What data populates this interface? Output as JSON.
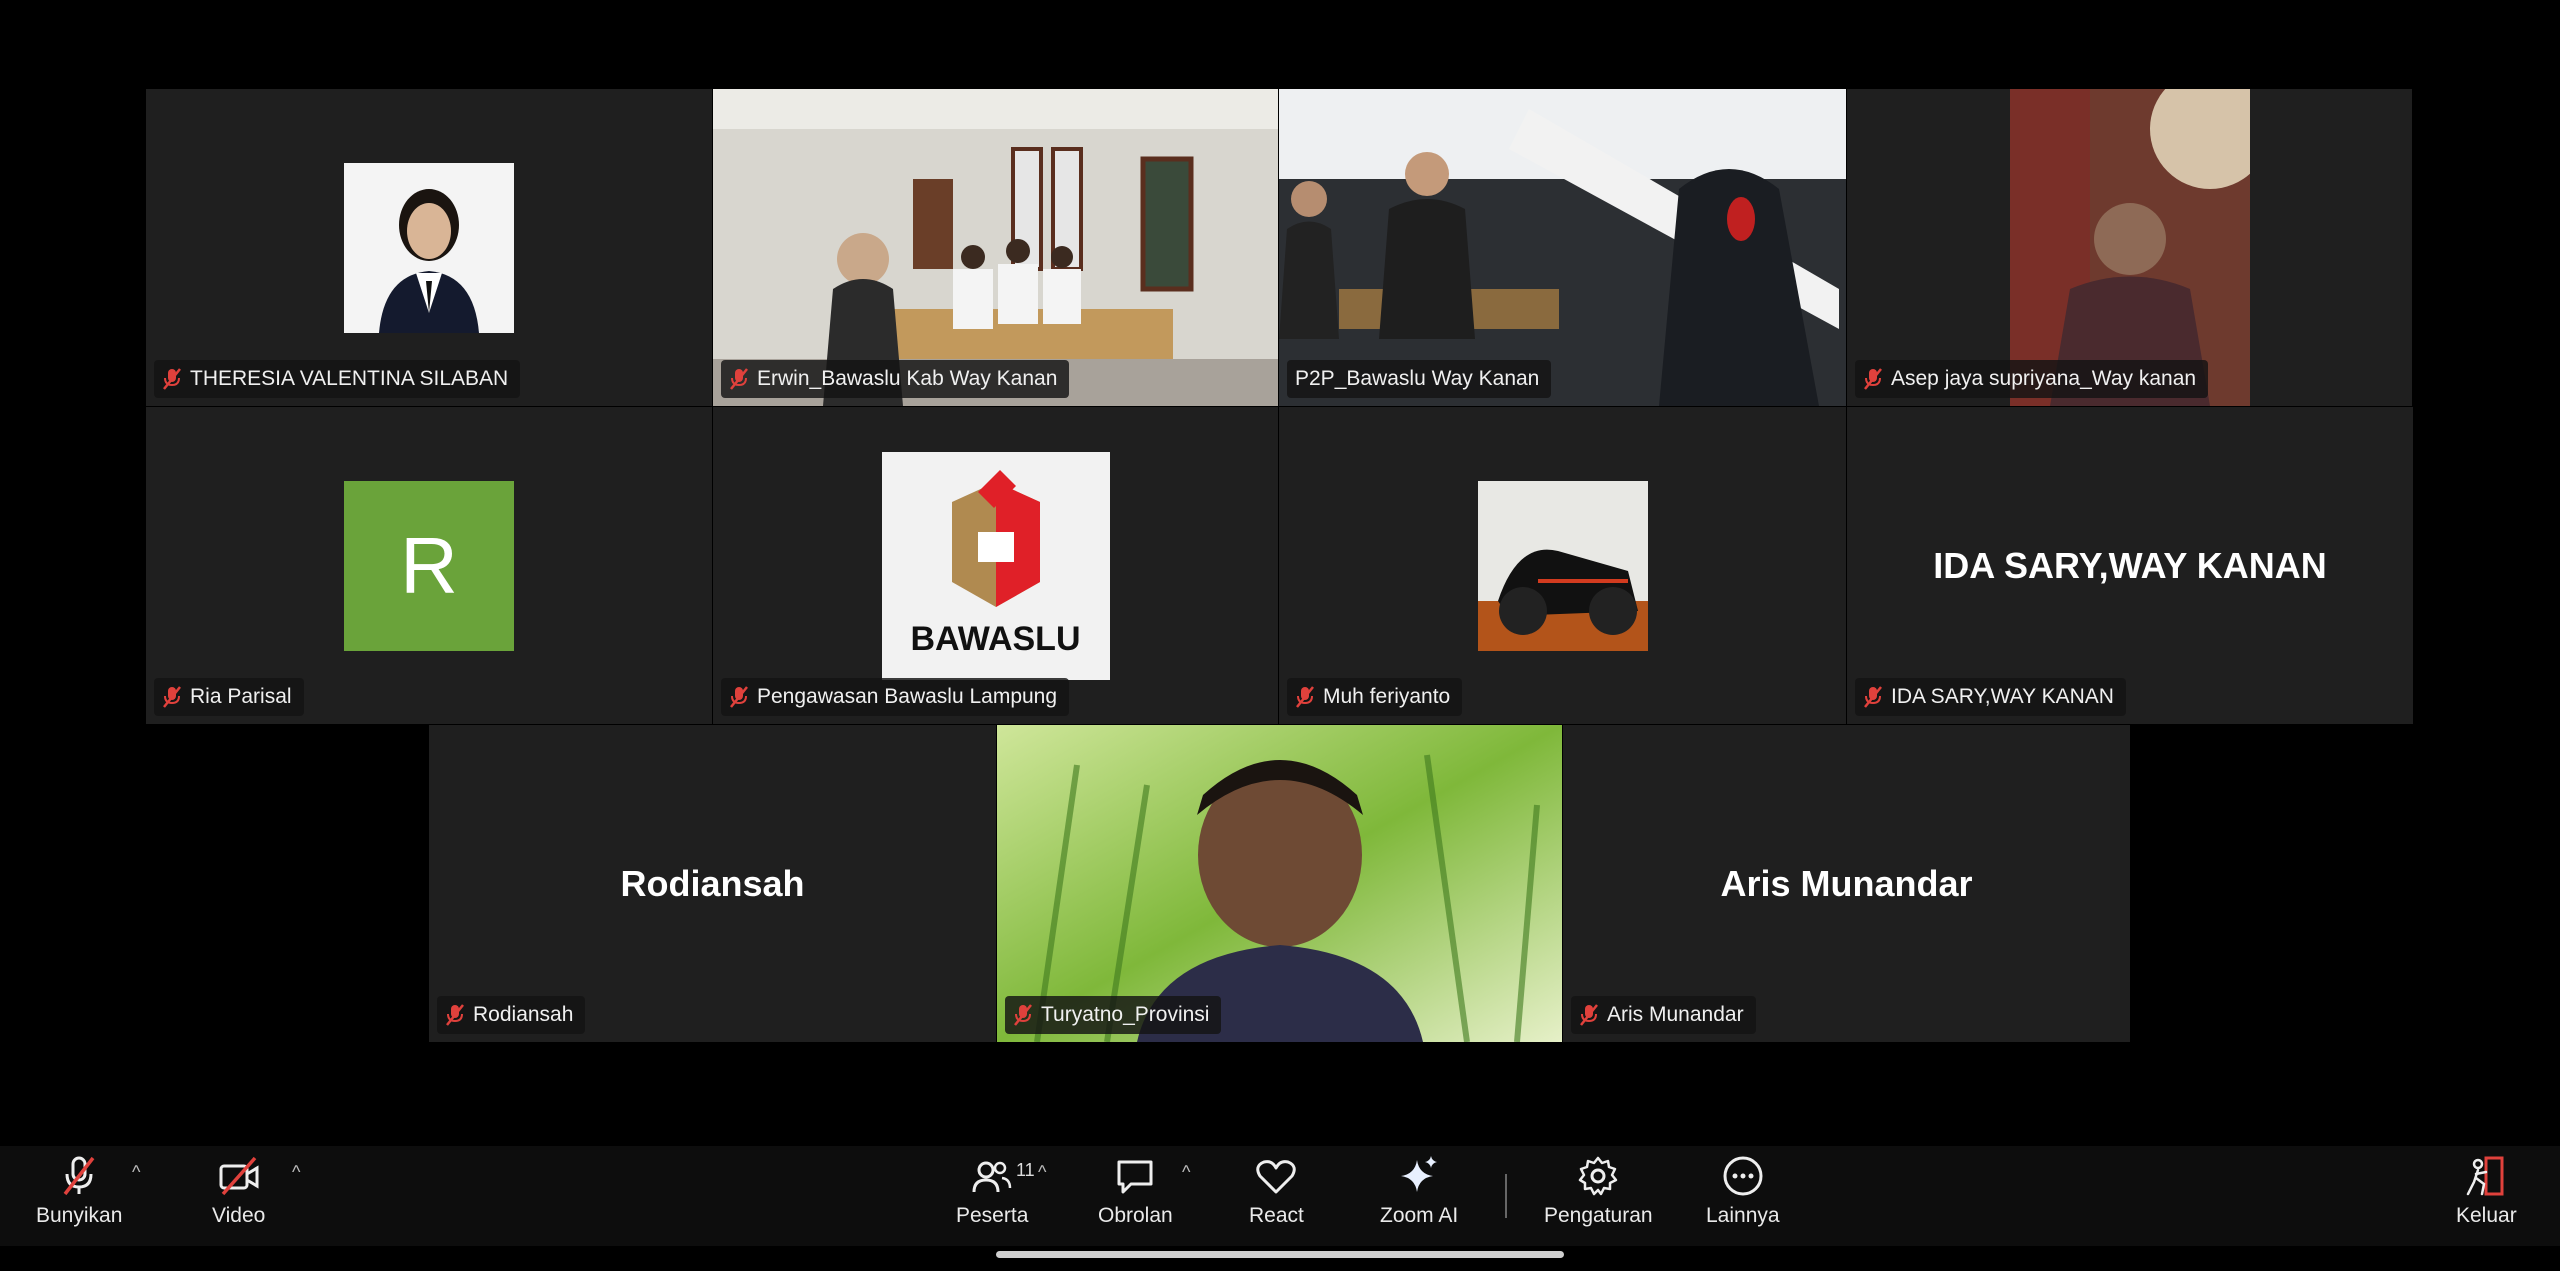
{
  "tiles": [
    {
      "name": "THERESIA VALENTINA SILABAN",
      "type": "photo"
    },
    {
      "name": "Erwin_Bawaslu Kab Way Kanan",
      "type": "video"
    },
    {
      "name": "P2P_Bawaslu Way Kanan",
      "type": "video",
      "active": true
    },
    {
      "name": "Asep jaya supriyana_Way kanan",
      "type": "video"
    },
    {
      "name": "Ria Parisal",
      "type": "initial",
      "initial": "R",
      "color": "#6aa33a"
    },
    {
      "name": "Pengawasan Bawaslu Lampung",
      "type": "logo"
    },
    {
      "name": "Muh feriyanto",
      "type": "photo"
    },
    {
      "name": "IDA SARY,WAY KANAN",
      "type": "name",
      "display": "IDA SARY,WAY KANAN"
    },
    {
      "name": "Rodiansah",
      "type": "name",
      "display": "Rodiansah"
    },
    {
      "name": "Turyatno_Provinsi",
      "type": "video"
    },
    {
      "name": "Aris Munandar",
      "type": "name",
      "display": "Aris Munandar"
    }
  ],
  "logo_text": "BAWASLU",
  "toolbar": {
    "unmute": "Bunyikan",
    "video": "Video",
    "participants": "Peserta",
    "participants_count": "11",
    "chat": "Obrolan",
    "react": "React",
    "zoom_ai": "Zoom AI",
    "settings": "Pengaturan",
    "more": "Lainnya",
    "leave": "Keluar"
  },
  "colors": {
    "active_speaker": "#2ed13a",
    "mute": "#e0413c",
    "leave": "#e0413c"
  }
}
